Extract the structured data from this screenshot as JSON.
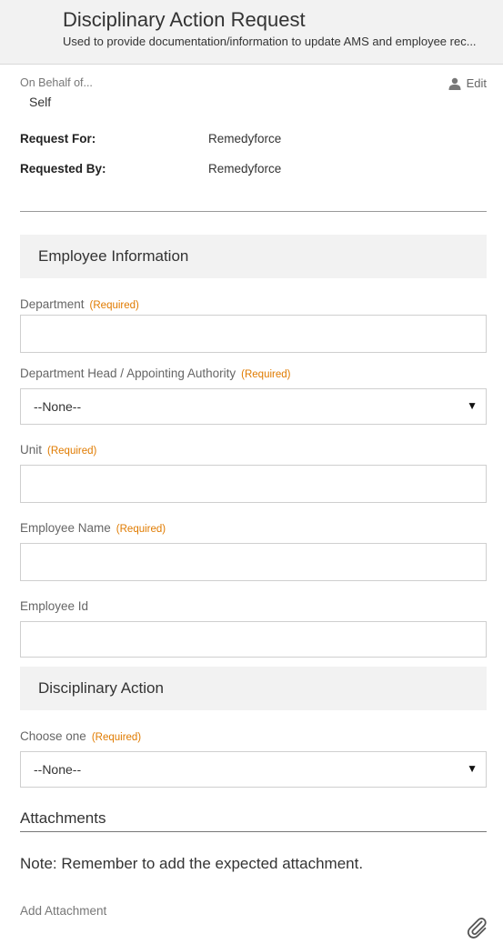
{
  "header": {
    "title": "Disciplinary Action Request",
    "subtitle": "Used to provide documentation/information to update AMS and employee rec..."
  },
  "on_behalf": {
    "label": "On Behalf of...",
    "value": "Self",
    "edit_label": "Edit",
    "edit_icon": "user-icon"
  },
  "request_info": {
    "request_for_label": "Request For:",
    "request_for_value": "Remedyforce",
    "requested_by_label": "Requested By:",
    "requested_by_value": "Remedyforce"
  },
  "sections": {
    "employee_information": "Employee Information",
    "disciplinary_action": "Disciplinary Action"
  },
  "required_text": "(Required)",
  "fields": {
    "department": {
      "label": "Department",
      "value": "",
      "required": true
    },
    "department_head": {
      "label": "Department Head / Appointing Authority",
      "value": "--None--",
      "required": true
    },
    "unit": {
      "label": "Unit",
      "value": "",
      "required": true
    },
    "employee_name": {
      "label": "Employee Name",
      "value": "",
      "required": true
    },
    "employee_id": {
      "label": "Employee Id",
      "value": "",
      "required": false
    },
    "choose_one": {
      "label": "Choose one",
      "value": "--None--",
      "required": true
    }
  },
  "attachments": {
    "title": "Attachments",
    "note": "Note: Remember to add the expected attachment.",
    "add_label": "Add Attachment",
    "add_icon": "paperclip-icon"
  },
  "colors": {
    "required": "#e07b00",
    "header_bg": "#f2f2f2",
    "section_bg": "#f2f2f2"
  }
}
